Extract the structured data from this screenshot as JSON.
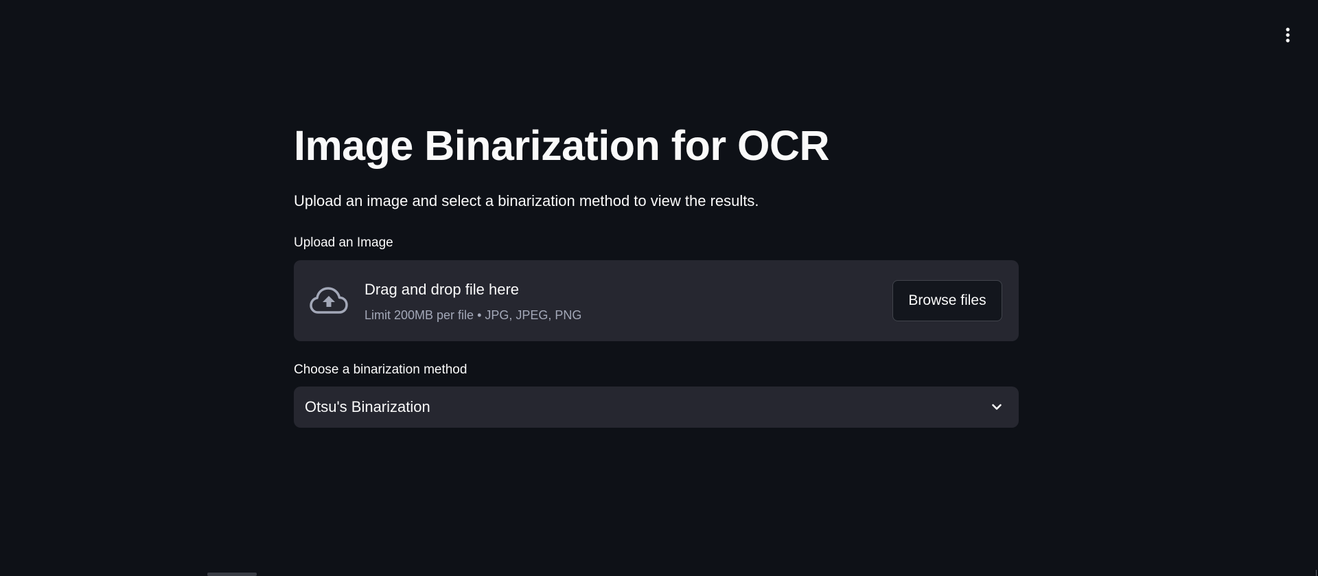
{
  "header": {
    "menu_icon": "vertical-ellipsis-icon"
  },
  "main": {
    "title": "Image Binarization for OCR",
    "subtitle": "Upload an image and select a binarization method to view the results."
  },
  "uploader": {
    "label": "Upload an Image",
    "icon": "cloud-upload-icon",
    "dropzone_title": "Drag and drop file here",
    "limit_text": "Limit 200MB per file • JPG, JPEG, PNG",
    "browse_label": "Browse files"
  },
  "method_select": {
    "label": "Choose a binarization method",
    "selected_value": "Otsu's Binarization",
    "icon": "chevron-down-icon"
  },
  "colors": {
    "background": "#0e1117",
    "surface": "#262730",
    "text": "#fafafa",
    "muted_text": "#a3a8b8",
    "button_border": "#41444c"
  }
}
